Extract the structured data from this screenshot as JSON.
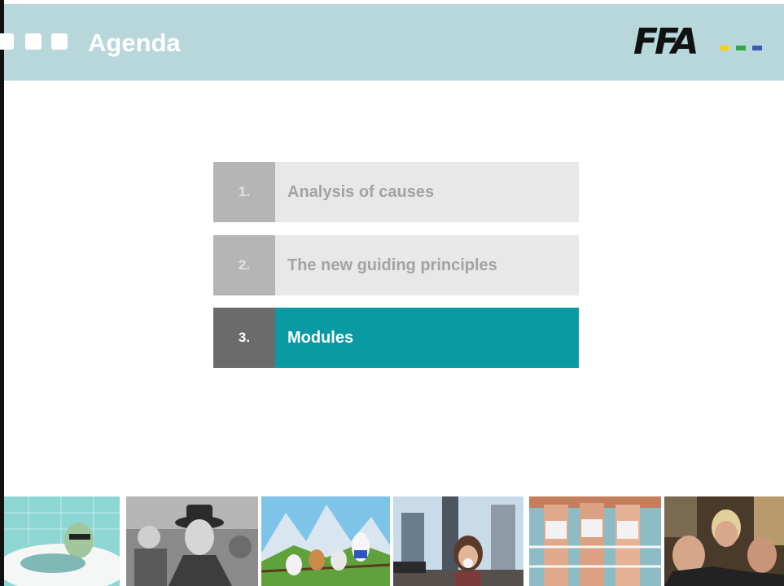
{
  "header": {
    "title": "Agenda",
    "logo_text": "FFA",
    "bg_color": "#b8d7db",
    "logo_bar_colors": [
      "#f2d21b",
      "#2aa84a",
      "#3b5bb5"
    ]
  },
  "agenda": {
    "items": [
      {
        "number": "1.",
        "label": "Analysis of causes",
        "active": false
      },
      {
        "number": "2.",
        "label": "The new guiding principles",
        "active": false
      },
      {
        "number": "3.",
        "label": "Modules",
        "active": true
      }
    ],
    "colors": {
      "inactive_num_bg": "#b5b5b5",
      "inactive_label_bg": "#e8e8e8",
      "inactive_text": "#a3a3a3",
      "active_num_bg": "#6b6b6b",
      "active_label_bg": "#0a9aa4",
      "active_text": "#ffffff"
    }
  },
  "photos": [
    {
      "name": "photo-bathtub-man"
    },
    {
      "name": "photo-man-with-hat"
    },
    {
      "name": "photo-animated-birds"
    },
    {
      "name": "photo-girl-bubblegum"
    },
    {
      "name": "photo-legs-on-railing"
    },
    {
      "name": "photo-group-portrait"
    }
  ]
}
